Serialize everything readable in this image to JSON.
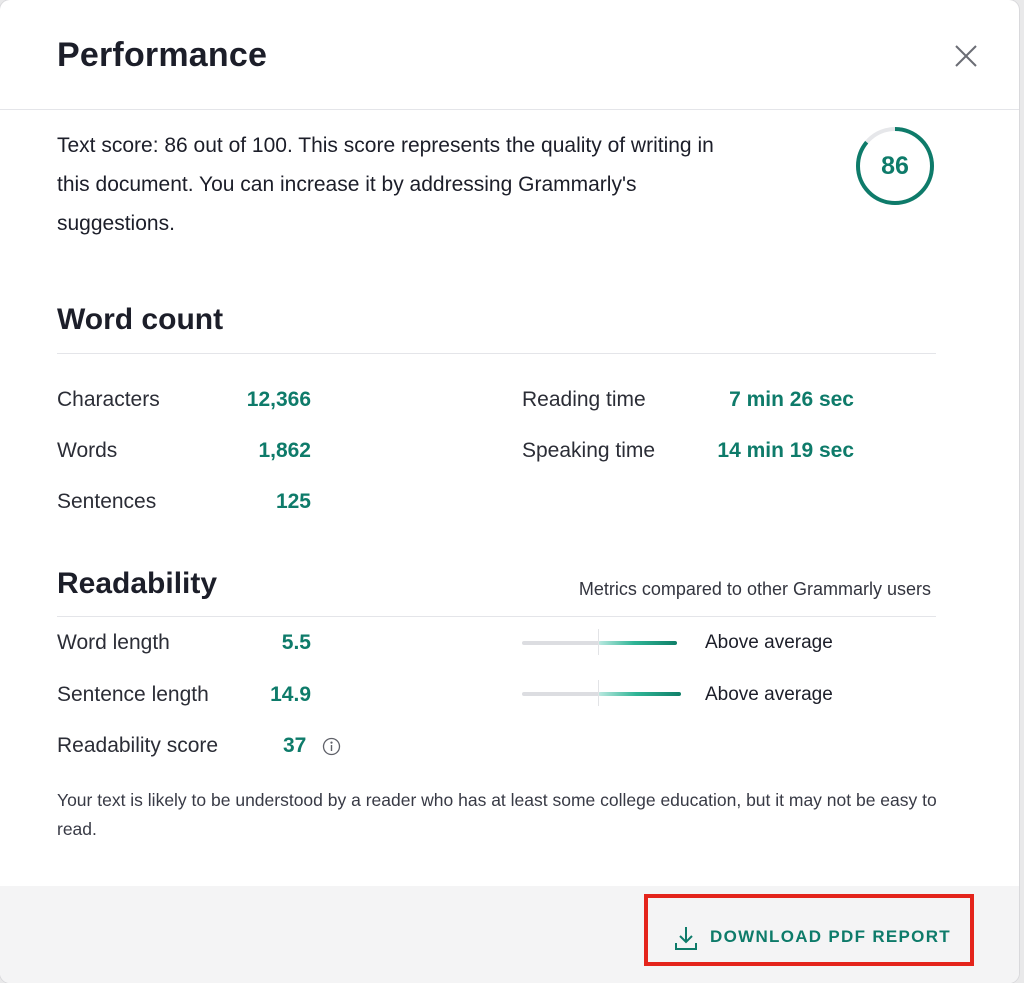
{
  "dialog": {
    "title": "Performance",
    "close_icon": "close-icon"
  },
  "score": {
    "text": "Text score: 86 out of 100. This score represents the quality of writing in this document. You can increase it by addressing Grammarly's suggestions.",
    "value": "86",
    "fraction": 0.86,
    "accent_color": "#0e7b6a"
  },
  "word_count": {
    "title": "Word count",
    "characters_label": "Characters",
    "characters_value": "12,366",
    "words_label": "Words",
    "words_value": "1,862",
    "sentences_label": "Sentences",
    "sentences_value": "125",
    "reading_time_label": "Reading time",
    "reading_time_value": "7 min 26 sec",
    "speaking_time_label": "Speaking time",
    "speaking_time_value": "14 min 19 sec"
  },
  "readability": {
    "title": "Readability",
    "metrics_note": "Metrics compared to other Grammarly users",
    "word_length_label": "Word length",
    "word_length_value": "5.5",
    "word_length_comparison": "Above average",
    "word_length_level": 0.51,
    "sentence_length_label": "Sentence length",
    "sentence_length_value": "14.9",
    "sentence_length_comparison": "Above average",
    "sentence_length_level": 0.54,
    "score_label": "Readability score",
    "score_value": "37",
    "info_icon": "info-icon",
    "description": "Your text is likely to be understood by a reader who has at least some college education, but it may not be easy to read."
  },
  "footer": {
    "download_label": "DOWNLOAD PDF REPORT",
    "download_icon": "download-icon",
    "highlight_color": "#e4241b"
  }
}
